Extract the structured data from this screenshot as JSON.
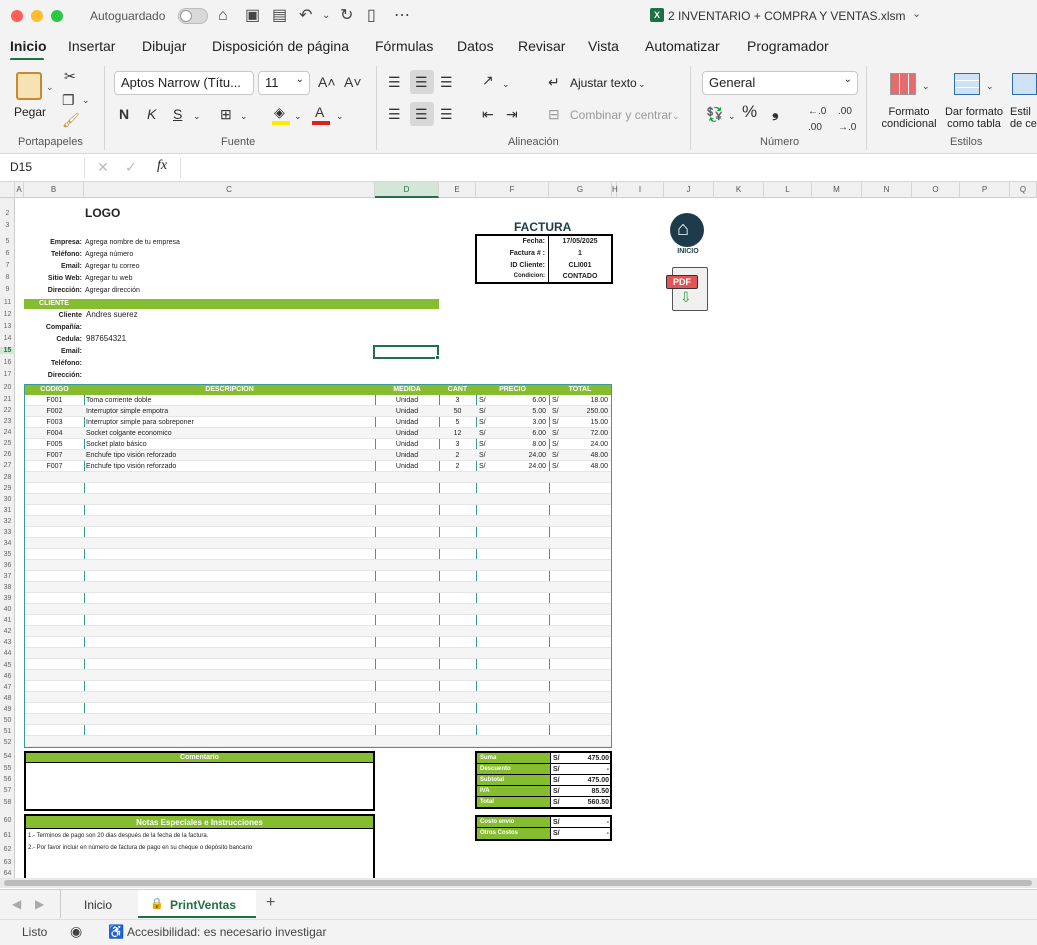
{
  "titlebar": {
    "autosave": "Autoguardado",
    "filename": "2 INVENTARIO + COMPRA Y VENTAS.xlsm",
    "icons": [
      "home-icon",
      "save-icon",
      "edit-save-icon",
      "undo-icon",
      "redo-icon",
      "new-file-icon",
      "more-icon"
    ]
  },
  "tabs": [
    "Inicio",
    "Insertar",
    "Dibujar",
    "Disposición de página",
    "Fórmulas",
    "Datos",
    "Revisar",
    "Vista",
    "Automatizar",
    "Programador"
  ],
  "ribbon": {
    "paste": "Pegar",
    "font_name": "Aptos Narrow (Títu...",
    "font_size": "11",
    "wrap": "Ajustar texto",
    "merge": "Combinar y centrar",
    "number_format": "General",
    "cond_format": [
      "Formato",
      "condicional"
    ],
    "table_format": [
      "Dar formato",
      "como tabla"
    ],
    "cell_styles": [
      "Estil",
      "de ce"
    ],
    "groups": [
      "Portapapeles",
      "Fuente",
      "Alineación",
      "Número",
      "Estilos"
    ],
    "bold": "N",
    "italic": "K",
    "underline": "S",
    "percent": "%",
    "comma": "❟"
  },
  "formula_bar": {
    "cell_ref": "D15",
    "fx": "fx",
    "cancel": "✕",
    "accept": "✓"
  },
  "columns": [
    "A",
    "B",
    "C",
    "D",
    "E",
    "F",
    "G",
    "H",
    "I",
    "J",
    "K",
    "L",
    "M",
    "N",
    "O",
    "P",
    "Q"
  ],
  "rows": [
    "2",
    "3",
    "5",
    "6",
    "7",
    "8",
    "9",
    "11",
    "12",
    "13",
    "14",
    "15",
    "16",
    "17",
    "20",
    "21",
    "22",
    "23",
    "24",
    "25",
    "26",
    "27",
    "28",
    "29",
    "30",
    "31",
    "32",
    "33",
    "34",
    "35",
    "36",
    "37",
    "38",
    "39",
    "40",
    "41",
    "42",
    "43",
    "44",
    "45",
    "46",
    "47",
    "48",
    "49",
    "50",
    "51",
    "52",
    "54",
    "55",
    "56",
    "57",
    "58",
    "60",
    "61",
    "62",
    "63",
    "64"
  ],
  "invoice": {
    "logo": "LOGO",
    "title": "FACTURA",
    "company_labels": [
      "Empresa:",
      "Teléfono:",
      "Email:",
      "Sitio Web:",
      "Dirección:"
    ],
    "company_values": [
      "Agrega nombre de tu empresa",
      "Agrega número",
      "Agregar tu correo",
      "Agregar tu web",
      "Agregar dirección"
    ],
    "meta_labels": [
      "Fecha:",
      "Factura # :",
      "ID Cliente:",
      "Condicion:"
    ],
    "meta_values": [
      "17/05/2025",
      "1",
      "CLI001",
      "CONTADO"
    ],
    "client_header": "CLIENTE",
    "client_labels": [
      "Cliente",
      "Compañía:",
      "Cedula:",
      "Email:",
      "Teléfono:",
      "Dirección:"
    ],
    "client_values": [
      "Andres suerez",
      "",
      "987654321",
      "",
      "",
      ""
    ],
    "table_headers": [
      "CODIGO",
      "DESCRIPCION",
      "MEDIDA",
      "CANT",
      "PRECIO",
      "TOTAL"
    ],
    "items": [
      {
        "code": "F001",
        "desc": "Toma corriente doble",
        "unit": "Unidad",
        "qty": "3",
        "cur": "S/",
        "price": "6.00",
        "cur2": "S/",
        "total": "18.00"
      },
      {
        "code": "F002",
        "desc": "Interruptor simple empotra",
        "unit": "Unidad",
        "qty": "50",
        "cur": "S/",
        "price": "5.00",
        "cur2": "S/",
        "total": "250.00"
      },
      {
        "code": "F003",
        "desc": "Interruptor simple para sobreponer",
        "unit": "Unidad",
        "qty": "5",
        "cur": "S/",
        "price": "3.00",
        "cur2": "S/",
        "total": "15.00"
      },
      {
        "code": "F004",
        "desc": "Socket colgante economico",
        "unit": "Unidad",
        "qty": "12",
        "cur": "S/",
        "price": "6.00",
        "cur2": "S/",
        "total": "72.00"
      },
      {
        "code": "F005",
        "desc": "Socket plato básico",
        "unit": "Unidad",
        "qty": "3",
        "cur": "S/",
        "price": "8.00",
        "cur2": "S/",
        "total": "24.00"
      },
      {
        "code": "F007",
        "desc": "Enchufe tipo visión reforzado",
        "unit": "Unidad",
        "qty": "2",
        "cur": "S/",
        "price": "24.00",
        "cur2": "S/",
        "total": "48.00"
      },
      {
        "code": "F007",
        "desc": "Enchufe tipo visión reforzado",
        "unit": "Unidad",
        "qty": "2",
        "cur": "S/",
        "price": "24.00",
        "cur2": "S/",
        "total": "48.00"
      }
    ],
    "comment_header": "Comentario",
    "totals": [
      {
        "label": "Suma",
        "cur": "S/",
        "value": "475.00"
      },
      {
        "label": "Descuento",
        "cur": "S/",
        "value": "-"
      },
      {
        "label": "Subtotal",
        "cur": "S/",
        "value": "475.00"
      },
      {
        "label": "IVA",
        "cur": "S/",
        "value": "85.50"
      },
      {
        "label": "Total",
        "cur": "S/",
        "value": "560.50"
      }
    ],
    "extra": [
      {
        "label": "Costo envío",
        "cur": "S/",
        "value": "-"
      },
      {
        "label": "Otros Costos",
        "cur": "S/",
        "value": "-"
      }
    ],
    "notes_header": "Notas Especiales e Instrucciones",
    "notes": [
      "1.- Terminos de pago son 20 dias después de la fecha de la factura.",
      "2.- Por favor incluir en número de factura de pago en su cheque o depósito bancario"
    ],
    "inicio_button": "INICIO",
    "pdf_label": "PDF"
  },
  "sheet_tabs": [
    "Inicio",
    "PrintVentas"
  ],
  "status": {
    "ready": "Listo",
    "accessibility": "Accesibilidad: es necesario investigar"
  }
}
